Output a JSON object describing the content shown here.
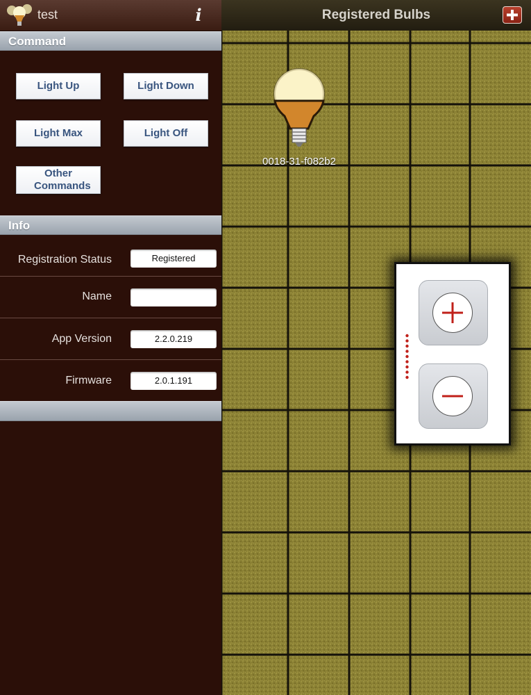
{
  "left_panel": {
    "app_name": "test",
    "command_section": {
      "title": "Command",
      "buttons": {
        "light_up": "Light Up",
        "light_down": "Light Down",
        "light_max": "Light Max",
        "light_off": "Light Off",
        "other": "Other Commands"
      }
    },
    "info_section": {
      "title": "Info",
      "rows": [
        {
          "label": "Registration Status",
          "value": "Registered"
        },
        {
          "label": "Name",
          "value": ""
        },
        {
          "label": "App Version",
          "value": "2.2.0.219"
        },
        {
          "label": "Firmware",
          "value": "2.0.1.191"
        }
      ]
    }
  },
  "right_panel": {
    "title": "Registered Bulbs",
    "bulbs": [
      {
        "id": "0018-31-f082b2"
      }
    ],
    "dimmer": {
      "level_dots": 9
    }
  },
  "colors": {
    "grid_tile": "#8c8235",
    "grid_line": "#1a1608",
    "left_bg": "#2b0f08",
    "section_header": "#a8b0b8",
    "button_text": "#39557f",
    "dimmer_symbol": "#c0201a"
  }
}
